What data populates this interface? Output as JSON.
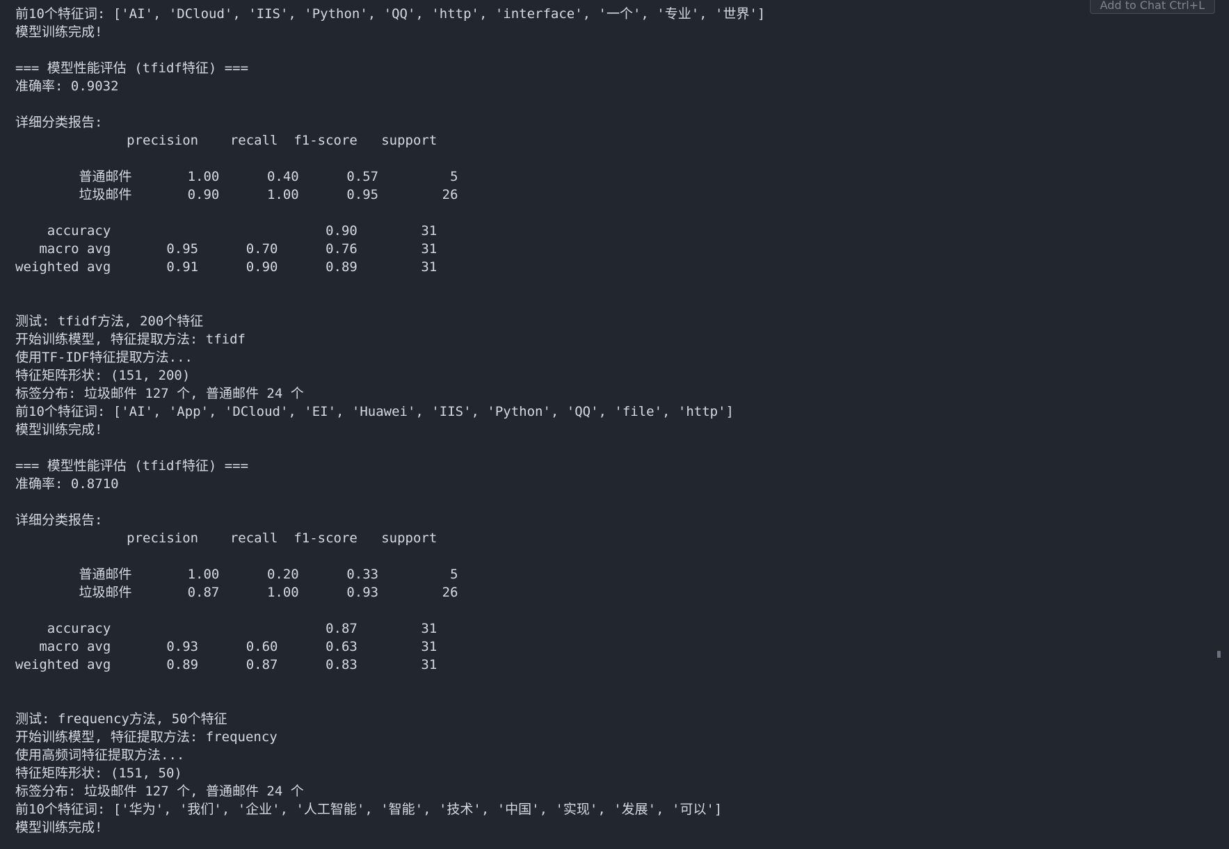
{
  "colors": {
    "background": "#22262e",
    "text": "#d5d9e0",
    "button_bg": "#2c3038",
    "button_text": "#7f858f"
  },
  "overlay": {
    "add_to_chat_label": "Add to Chat Ctrl+L"
  },
  "terminal": {
    "lines": [
      "前10个特征词: ['AI', 'DCloud', 'IIS', 'Python', 'QQ', 'http', 'interface', '一个', '专业', '世界']",
      "模型训练完成!",
      "",
      "=== 模型性能评估 (tfidf特征) ===",
      "准确率: 0.9032",
      "",
      "详细分类报告:",
      "              precision    recall  f1-score   support",
      "",
      "        普通邮件       1.00      0.40      0.57         5",
      "        垃圾邮件       0.90      1.00      0.95        26",
      "",
      "    accuracy                           0.90        31",
      "   macro avg       0.95      0.70      0.76        31",
      "weighted avg       0.91      0.90      0.89        31",
      "",
      "",
      "测试: tfidf方法, 200个特征",
      "开始训练模型, 特征提取方法: tfidf",
      "使用TF-IDF特征提取方法...",
      "特征矩阵形状: (151, 200)",
      "标签分布: 垃圾邮件 127 个, 普通邮件 24 个",
      "前10个特征词: ['AI', 'App', 'DCloud', 'EI', 'Huawei', 'IIS', 'Python', 'QQ', 'file', 'http']",
      "模型训练完成!",
      "",
      "=== 模型性能评估 (tfidf特征) ===",
      "准确率: 0.8710",
      "",
      "详细分类报告:",
      "              precision    recall  f1-score   support",
      "",
      "        普通邮件       1.00      0.20      0.33         5",
      "        垃圾邮件       0.87      1.00      0.93        26",
      "",
      "    accuracy                           0.87        31",
      "   macro avg       0.93      0.60      0.63        31",
      "weighted avg       0.89      0.87      0.83        31",
      "",
      "",
      "测试: frequency方法, 50个特征",
      "开始训练模型, 特征提取方法: frequency",
      "使用高频词特征提取方法...",
      "特征矩阵形状: (151, 50)",
      "标签分布: 垃圾邮件 127 个, 普通邮件 24 个",
      "前10个特征词: ['华为', '我们', '企业', '人工智能', '智能', '技术', '中国', '实现', '发展', '可以']",
      "模型训练完成!"
    ]
  }
}
